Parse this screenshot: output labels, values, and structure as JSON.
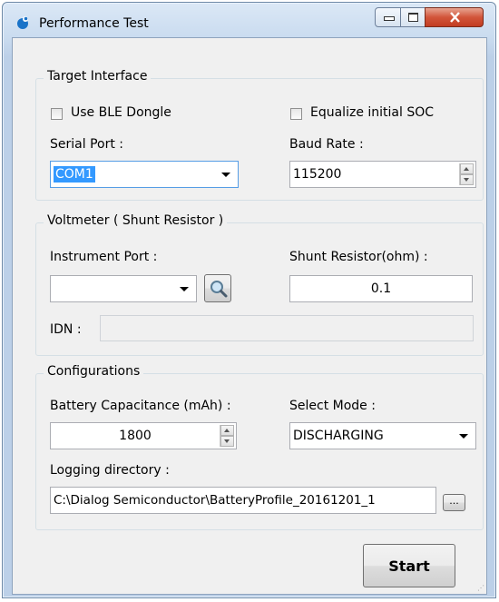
{
  "window": {
    "title": "Performance Test"
  },
  "target": {
    "legend": "Target Interface",
    "use_ble_label": "Use BLE Dongle",
    "equalize_label": "Equalize initial SOC",
    "serial_port_label": "Serial Port :",
    "serial_port_value": "COM1",
    "baud_rate_label": "Baud Rate :",
    "baud_rate_value": "115200"
  },
  "voltmeter": {
    "legend": "Voltmeter ( Shunt Resistor )",
    "instrument_port_label": "Instrument Port :",
    "instrument_port_value": "",
    "shunt_label": "Shunt Resistor(ohm) :",
    "shunt_value": "0.1",
    "idn_label": "IDN :",
    "idn_value": ""
  },
  "config": {
    "legend": "Configurations",
    "capacitance_label": "Battery Capacitance (mAh) :",
    "capacitance_value": "1800",
    "mode_label": "Select Mode :",
    "mode_value": "DISCHARGING",
    "logging_label": "Logging directory :",
    "logging_value": "C:\\Dialog Semiconductor\\BatteryProfile_20161201_1",
    "browse_label": "..."
  },
  "start_label": "Start",
  "colors": {
    "selection": "#3399ff",
    "close": "#c23c22"
  }
}
